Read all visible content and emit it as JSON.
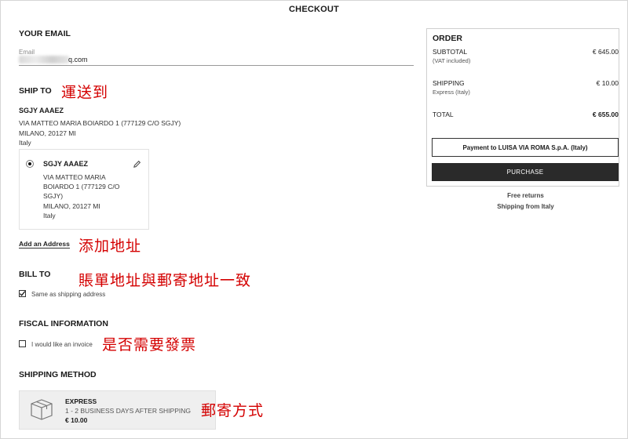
{
  "header": {
    "title": "CHECKOUT"
  },
  "email": {
    "section_title": "YOUR EMAIL",
    "field_label": "Email",
    "value_visible": "q.com"
  },
  "ship_to": {
    "section_title": "SHIP TO",
    "annotation": "運送到",
    "name": "SGJY AAAEZ",
    "address_lines": [
      "VIA MATTEO MARIA BOIARDO 1 (777129 C/O SGJY)",
      "MILANO, 20127 MI",
      "Italy"
    ],
    "card": {
      "name": "SGJY AAAEZ",
      "lines": [
        "VIA MATTEO MARIA",
        "BOIARDO 1 (777129 C/O",
        "SGJY)",
        "MILANO, 20127 MI",
        "Italy"
      ],
      "selected": true
    },
    "add_address": "Add an Address",
    "add_address_annotation": "添加地址"
  },
  "bill_to": {
    "section_title": "BILL TO",
    "annotation": "賬單地址與郵寄地址一致",
    "same_as_shipping_label": "Same as shipping address",
    "same_as_shipping_checked": true
  },
  "fiscal": {
    "section_title": "FISCAL INFORMATION",
    "invoice_label": "I would like an invoice",
    "invoice_checked": false,
    "annotation": "是否需要發票"
  },
  "shipping_method": {
    "section_title": "SHIPPING METHOD",
    "annotation": "郵寄方式",
    "option": {
      "name": "EXPRESS",
      "detail": "1 - 2 BUSINESS DAYS AFTER SHIPPING",
      "price": "€ 10.00"
    }
  },
  "order": {
    "title": "ORDER",
    "subtotal_label": "SUBTOTAL",
    "subtotal_note": "(VAT included)",
    "subtotal_value": "€ 645.00",
    "shipping_label": "SHIPPING",
    "shipping_note": "Express (Italy)",
    "shipping_value": "€ 10.00",
    "total_label": "TOTAL",
    "total_value": "€ 655.00",
    "payment_button": "Payment to LUISA VIA ROMA S.p.A. (Italy)",
    "purchase_button": "PURCHASE",
    "notes": [
      "Free returns",
      "Shipping from Italy"
    ]
  },
  "colors": {
    "annotation": "#d40000",
    "primary_button": "#2a2a2a"
  },
  "icons": [
    "pencil-icon",
    "box-icon",
    "radio-selected-icon",
    "checkbox-icon"
  ]
}
